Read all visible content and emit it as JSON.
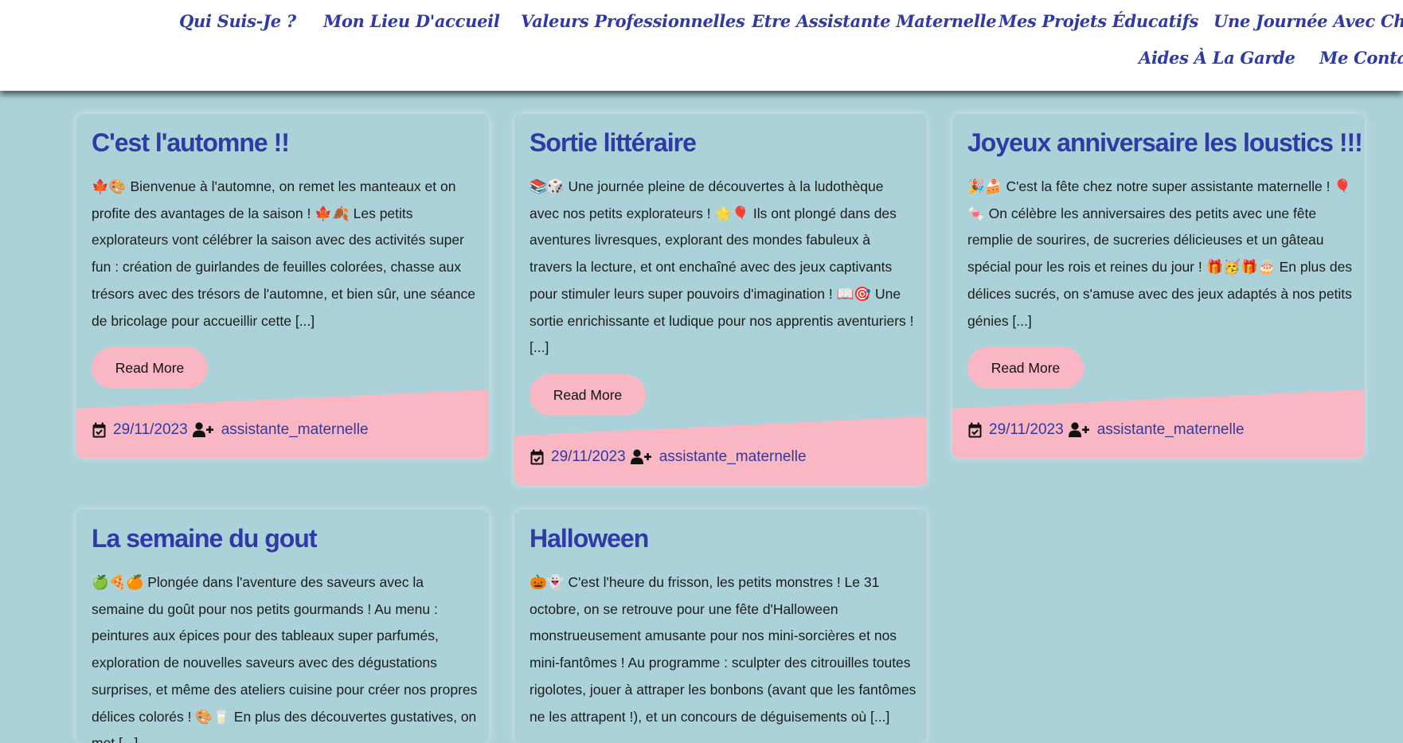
{
  "nav": {
    "row1": [
      "Qui Suis-Je ?",
      "Mon Lieu D'accueil",
      "Valeurs Professionnelles",
      "Etre Assistante Maternelle",
      "Mes Projets Éducatifs",
      "Une Journée Avec Charlè"
    ],
    "row2": [
      "Aides À La Garde",
      "Me Contac"
    ]
  },
  "posts": [
    {
      "title": "C'est l'automne !!",
      "excerpt": "🍁🎨 Bienvenue à l'automne, on remet les manteaux et on profite des avantages de la saison ! 🍁🍂 Les petits explorateurs vont célébrer la saison avec des activités super fun : création de guirlandes de feuilles colorées, chasse aux trésors avec des trésors de l'automne, et bien sûr, une séance de bricolage pour accueillir cette [...]",
      "read_more": "Read More",
      "date": "29/11/2023",
      "author": "assistante_maternelle"
    },
    {
      "title": "Sortie littéraire",
      "excerpt": "📚🎲 Une journée pleine de découvertes à la ludothèque avec nos petits explorateurs ! 🌟🎈 Ils ont plongé dans des aventures livresques, explorant des mondes fabuleux à travers la lecture, et ont enchaîné avec des jeux captivants pour stimuler leurs super pouvoirs d'imagination ! 📖🎯 Une sortie enrichissante et ludique pour nos apprentis aventuriers ! [...]",
      "read_more": "Read More",
      "date": "29/11/2023",
      "author": "assistante_maternelle"
    },
    {
      "title": "Joyeux anniversaire les loustics !!!",
      "excerpt": "🎉🍰 C'est la fête chez notre super assistante maternelle ! 🎈🍬 On célèbre les anniversaires des petits avec une fête remplie de sourires, de sucreries délicieuses et un gâteau spécial pour les rois et reines du jour ! 🎁🥳🎁🎂 En plus des délices sucrés, on s'amuse avec des jeux adaptés à nos petits génies [...]",
      "read_more": "Read More",
      "date": "29/11/2023",
      "author": "assistante_maternelle"
    },
    {
      "title": "La semaine du gout",
      "excerpt": "🍏🍕🍊 Plongée dans l'aventure des saveurs avec la semaine du goût pour nos petits gourmands ! Au menu : peintures aux épices pour des tableaux super parfumés, exploration de nouvelles saveurs avec des dégustations surprises, et même des ateliers cuisine pour créer nos propres délices colorés ! 🎨🥛 En plus des découvertes gustatives, on met [...]"
    },
    {
      "title": "Halloween",
      "excerpt": "🎃👻 C'est l'heure du frisson, les petits monstres ! Le 31 octobre, on se retrouve pour une fête d'Halloween monstrueusement amusante pour nos mini-sorcières et nos mini-fantômes ! Au programme : sculpter des citrouilles toutes rigolotes, jouer à attraper les bonbons (avant que les fantômes ne les attrapent !), et un concours de déguisements où [...]"
    }
  ],
  "icons": {
    "date": "calendar-check-icon",
    "author": "user-plus-icon"
  },
  "colors": {
    "background": "#acd2d9",
    "accent_pink": "#f9b7c3",
    "link_blue": "#2f3aa4",
    "header": "#ffffff"
  }
}
